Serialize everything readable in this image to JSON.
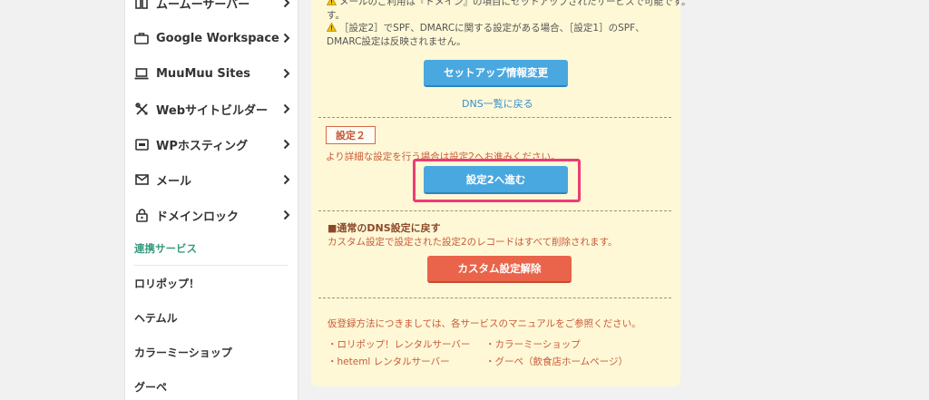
{
  "sidebar": {
    "items": [
      {
        "label": "ムームーサーバー",
        "icon": "server-icon"
      },
      {
        "label": "Google Workspace",
        "icon": "briefcase-icon"
      },
      {
        "label": "MuuMuu Sites",
        "icon": "laptop-icon"
      },
      {
        "label": "Webサイトビルダー",
        "icon": "tools-icon"
      },
      {
        "label": "WPホスティング",
        "icon": "wp-icon"
      },
      {
        "label": "メール",
        "icon": "mail-icon"
      },
      {
        "label": "ドメインロック",
        "icon": "lock-icon"
      }
    ],
    "section_heading": "連携サービス",
    "services": [
      "ロリポップ！",
      "ヘテムル",
      "カラーミーショップ",
      "グーペ"
    ]
  },
  "panel": {
    "note_line1": "メールのご利用は『ドメイン』の項目にセットアップされたサービスで可能です。",
    "note_line1b": "す。",
    "note_line2": "［設定2］でSPF、DMARCに関する設定がある場合、［設定1］のSPF、",
    "note_line3": "DMARC設定は反映されません。",
    "setup_button": "セットアップ情報変更",
    "dns_back_link": "DNS一覧に戻る",
    "setting2_tag": "設定２",
    "setting2_desc": "より詳細な設定を行う場合は設定2へお進みください。",
    "setting2_button": "設定2へ進む",
    "revert_heading": "■通常のDNS設定に戻す",
    "revert_desc": "カスタム設定で設定された設定2のレコードはすべて削除されます。",
    "cancel_button": "カスタム設定解除",
    "manual_note": "仮登録方法につきましては、各サービスのマニュアルをご参照ください。",
    "links": [
      "・ロリポップ！レンタルサーバー",
      "・カラーミーショップ",
      "・heteml レンタルサーバー",
      "・グーペ（飲食店ホームページ）"
    ]
  },
  "colors": {
    "panel_bg": "#fff8d6",
    "blue_button": "#4aa8e0",
    "red_button": "#e9644a",
    "highlight": "#ee3b74",
    "section_green": "#3a9b7f"
  }
}
